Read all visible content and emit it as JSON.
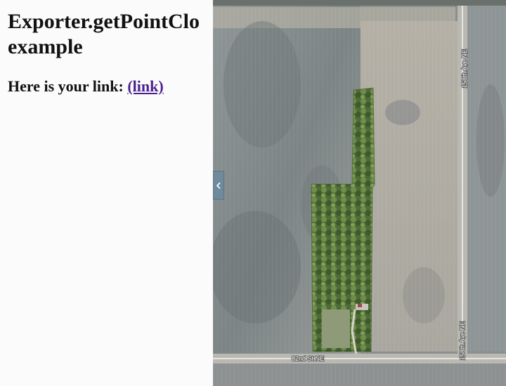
{
  "panel": {
    "title": "Exporter.getPointCloud example",
    "link_prefix": "Here is your link: ",
    "link_text": "(link)"
  },
  "map": {
    "collapse_icon": "chevron-left-icon",
    "road_labels": {
      "avenue_north": "158th Ave NE",
      "avenue_south": "158th Ave NE",
      "street_south": "82nd St NE"
    }
  }
}
